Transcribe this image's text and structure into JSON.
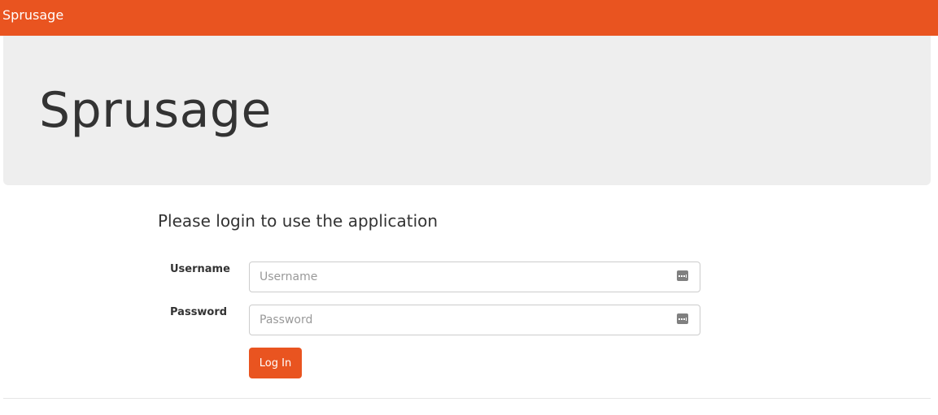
{
  "navbar": {
    "brand": "Sprusage",
    "color": "#E95420"
  },
  "jumbotron": {
    "title": "Sprusage",
    "background": "#EEEEEE"
  },
  "login": {
    "heading": "Please login to use the application",
    "username": {
      "label": "Username",
      "placeholder": "Username",
      "value": "",
      "icon": "password-manager-icon"
    },
    "password": {
      "label": "Password",
      "placeholder": "Password",
      "value": "",
      "icon": "password-manager-icon"
    },
    "submit_label": "Log In"
  }
}
